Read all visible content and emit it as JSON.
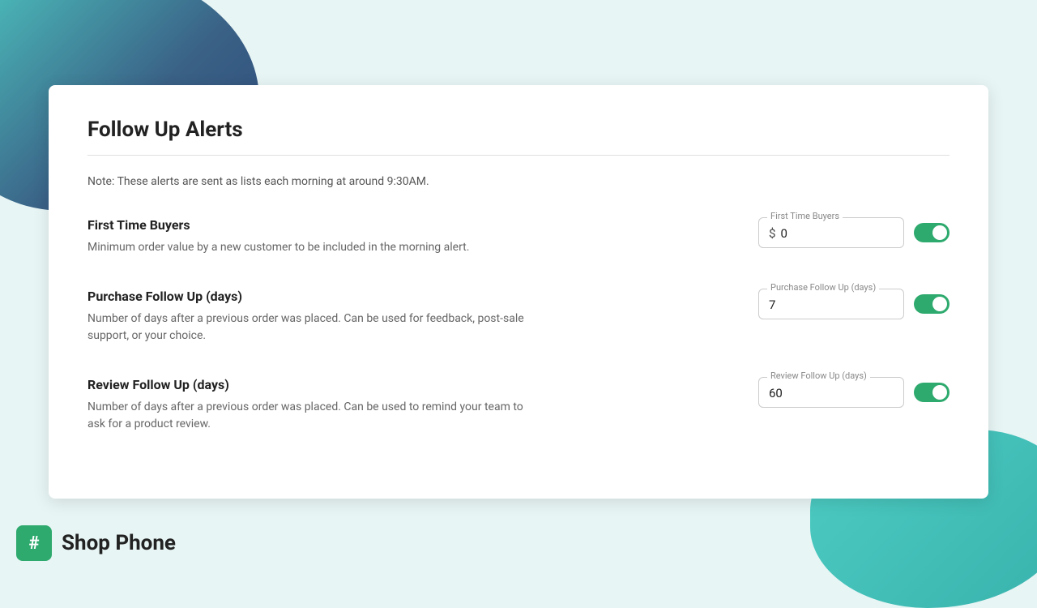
{
  "page": {
    "title": "Follow Up Alerts",
    "note": "Note: These alerts are sent as lists each morning at around 9:30AM.",
    "divider": true
  },
  "alerts": [
    {
      "id": "first-time-buyers",
      "title": "First Time Buyers",
      "description": "Minimum order value by a new customer to be included in the morning alert.",
      "field_label": "First Time Buyers",
      "field_prefix": "$",
      "field_value": "0",
      "toggle_enabled": true
    },
    {
      "id": "purchase-follow-up",
      "title": "Purchase Follow Up (days)",
      "description": "Number of days after a previous order was placed. Can be used for feedback, post-sale support, or your choice.",
      "field_label": "Purchase Follow Up (days)",
      "field_prefix": "",
      "field_value": "7",
      "toggle_enabled": true
    },
    {
      "id": "review-follow-up",
      "title": "Review Follow Up (days)",
      "description": "Number of days after a previous order was placed. Can be used to remind your team to ask for a product review.",
      "field_label": "Review Follow Up (days)",
      "field_prefix": "",
      "field_value": "60",
      "toggle_enabled": true
    }
  ],
  "brand": {
    "name": "Shop Phone",
    "icon": "#"
  },
  "colors": {
    "toggle_on": "#2eaa6e",
    "brand_green": "#2eaa6e"
  }
}
